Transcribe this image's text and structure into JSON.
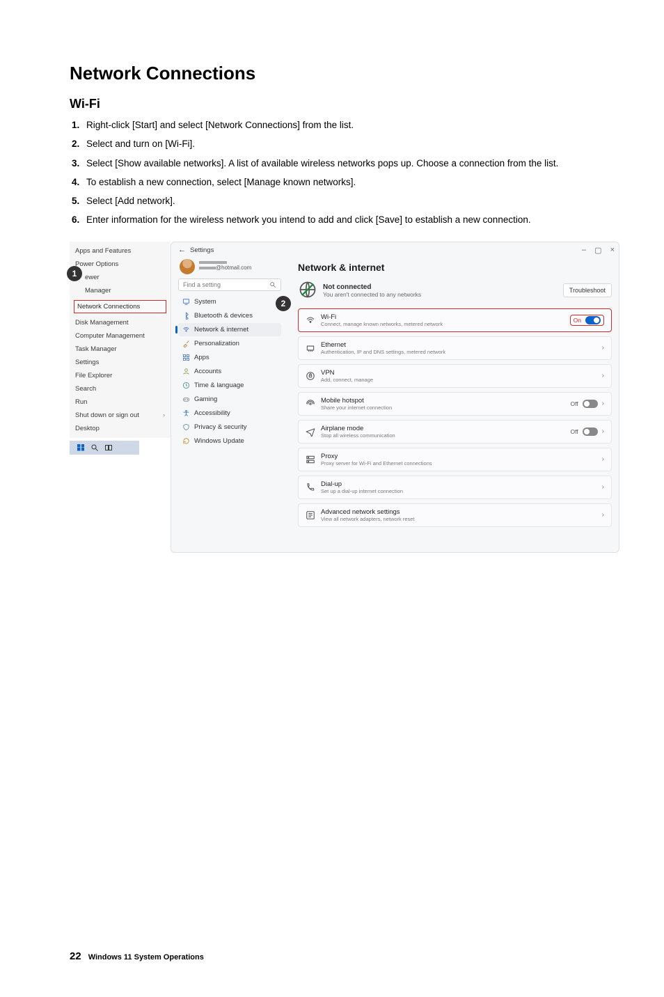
{
  "page": {
    "title": "Network Connections",
    "section_title": "Wi-Fi",
    "steps": [
      "Right-click [Start] and select [Network Connections] from the list.",
      "Select and turn on [Wi-Fi].",
      "Select [Show available networks]. A list of available wireless networks pops up. Choose a connection from the list.",
      "To establish a new connection, select [Manage known networks].",
      "Select [Add network].",
      "Enter information for the wireless network you intend to add and click [Save] to establish a new connection."
    ]
  },
  "context_menu": {
    "items_top": [
      "Apps and Features",
      "Power Options"
    ],
    "items_group1": [
      "ewer",
      "Manager"
    ],
    "highlight": "Network Connections",
    "items_mid": [
      "Disk Management",
      "Computer Management",
      "Task Manager",
      "Settings",
      "File Explorer",
      "Search",
      "Run"
    ],
    "sign_out": "Shut down or sign out",
    "desktop": "Desktop"
  },
  "settings_window": {
    "back_label": "Settings",
    "profile_email": "@hotmail.com",
    "search_placeholder": "Find a setting",
    "nav": [
      {
        "label": "System",
        "icon": "monitor"
      },
      {
        "label": "Bluetooth & devices",
        "icon": "bluetooth"
      },
      {
        "label": "Network & internet",
        "icon": "wifi",
        "active": true
      },
      {
        "label": "Personalization",
        "icon": "brush"
      },
      {
        "label": "Apps",
        "icon": "grid"
      },
      {
        "label": "Accounts",
        "icon": "user"
      },
      {
        "label": "Time & language",
        "icon": "clock"
      },
      {
        "label": "Gaming",
        "icon": "game"
      },
      {
        "label": "Accessibility",
        "icon": "accessibility"
      },
      {
        "label": "Privacy & security",
        "icon": "shield"
      },
      {
        "label": "Windows Update",
        "icon": "update"
      }
    ],
    "main_title": "Network & internet",
    "status": {
      "title": "Not connected",
      "subtitle": "You aren't connected to any networks",
      "troubleshoot": "Troubleshoot"
    },
    "rows": [
      {
        "icon": "wifi",
        "title": "Wi-Fi",
        "subtitle": "Connect, manage known networks, metered network",
        "right": {
          "type": "toggle",
          "state": "on",
          "label": "On"
        },
        "highlight": true
      },
      {
        "icon": "ethernet",
        "title": "Ethernet",
        "subtitle": "Authentication, IP and DNS settings, metered network",
        "right": {
          "type": "chevron"
        }
      },
      {
        "icon": "vpn",
        "title": "VPN",
        "subtitle": "Add, connect, manage",
        "right": {
          "type": "chevron"
        }
      },
      {
        "icon": "hotspot",
        "title": "Mobile hotspot",
        "subtitle": "Share your internet connection",
        "right": {
          "type": "toggle-chevron",
          "state": "off",
          "label": "Off"
        }
      },
      {
        "icon": "airplane",
        "title": "Airplane mode",
        "subtitle": "Stop all wireless communication",
        "right": {
          "type": "toggle-chevron",
          "state": "off",
          "label": "Off"
        }
      },
      {
        "icon": "proxy",
        "title": "Proxy",
        "subtitle": "Proxy server for Wi-Fi and Ethernet connections",
        "right": {
          "type": "chevron"
        }
      },
      {
        "icon": "dialup",
        "title": "Dial-up",
        "subtitle": "Set up a dial-up internet connection",
        "right": {
          "type": "chevron"
        }
      },
      {
        "icon": "advanced",
        "title": "Advanced network settings",
        "subtitle": "View all network adapters, network reset",
        "right": {
          "type": "chevron"
        }
      }
    ]
  },
  "callouts": {
    "one": "1",
    "two": "2"
  },
  "footer": {
    "page_number": "22",
    "label": "Windows 11 System Operations"
  }
}
